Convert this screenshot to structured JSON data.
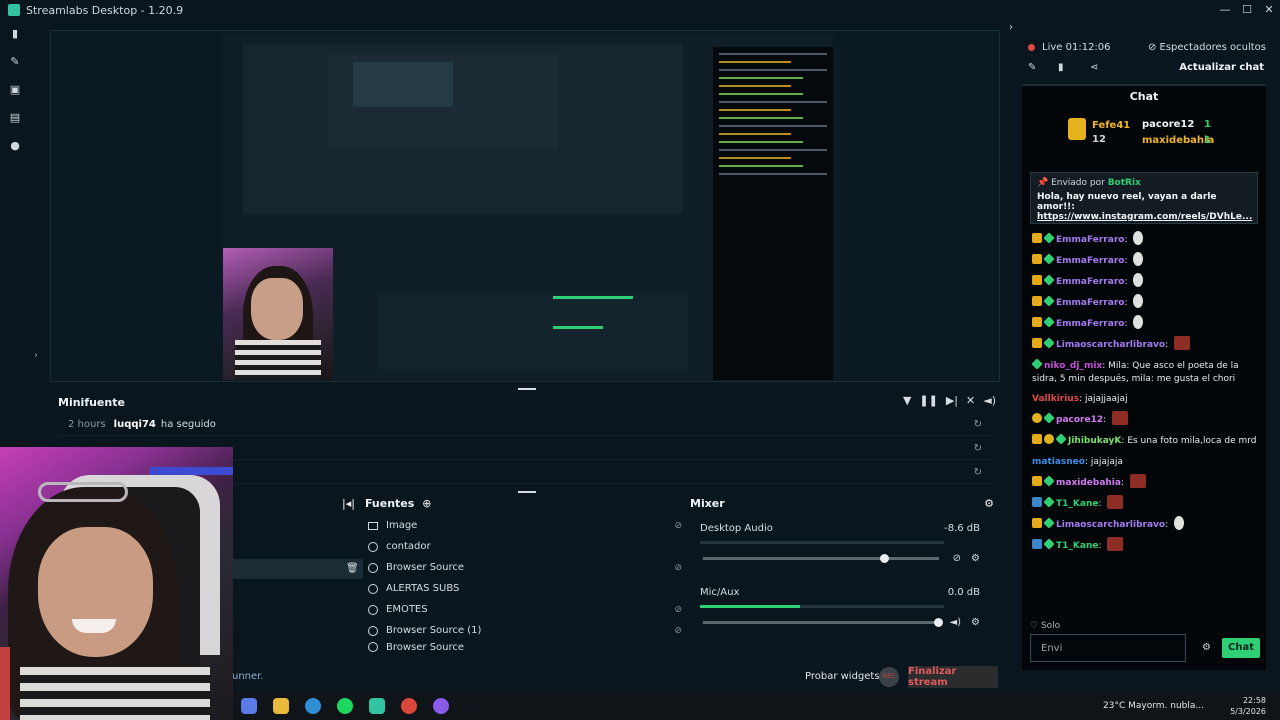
{
  "window": {
    "title": "Streamlabs Desktop - 1.20.9",
    "controls": [
      "—",
      "☐",
      "✕"
    ]
  },
  "nav": {
    "icons": [
      "editor-icon",
      "themes-icon",
      "store-icon",
      "dashboard-icon",
      "studio-icon"
    ],
    "collapse": "›"
  },
  "minifeed": {
    "title": "Minifuente",
    "rows": [
      {
        "time": "2 hours",
        "user": "luqqi74",
        "action": "ha seguido"
      },
      {
        "time": "",
        "user": "",
        "action": ""
      },
      {
        "time": "",
        "user": "",
        "action": ""
      }
    ]
  },
  "sources": {
    "title": "Fuentes",
    "items": [
      "Image",
      "contador",
      "Browser Source",
      "ALERTAS SUBS",
      "EMOTES",
      "Browser Source (1)",
      "Browser Source"
    ]
  },
  "mixer": {
    "title": "Mixer",
    "items": [
      {
        "name": "Desktop Audio",
        "db": "-8.6 dB",
        "level": 0.0,
        "volume": 0.77
      },
      {
        "name": "Mic/Aux",
        "db": "0.0 dB",
        "level": 0.41,
        "volume": 1.0
      }
    ]
  },
  "footer": {
    "widgets": "Probar widgets",
    "rec": "REC",
    "finish": "Finalizar stream",
    "runner": "unner."
  },
  "live": {
    "label": "Live",
    "time": "01:12:06",
    "viewers": "Espectadores ocultos",
    "update": "Actualizar chat"
  },
  "chat": {
    "title": "Chat",
    "leader": {
      "first": "Fefe41",
      "first_count": "12",
      "second": "pacore12",
      "second_count": "1",
      "third": "maxidebahia",
      "third_count": "1"
    },
    "pinned": {
      "sent_by": "Enviado por",
      "bot": "BotRix",
      "message": "Hola, hay nuevo reel, vayan a darle amor!!:",
      "link": "https://www.instagram.com/reels/DVhLe..."
    },
    "messages": [
      {
        "user": "EmmaFerraro",
        "color": "#a67bf2",
        "text": ""
      },
      {
        "user": "EmmaFerraro",
        "color": "#a67bf2",
        "text": ""
      },
      {
        "user": "EmmaFerraro",
        "color": "#a67bf2",
        "text": ""
      },
      {
        "user": "EmmaFerraro",
        "color": "#a67bf2",
        "text": ""
      },
      {
        "user": "EmmaFerraro",
        "color": "#a67bf2",
        "text": ""
      },
      {
        "user": "Limaoscarcharlibravo",
        "color": "#a67bf2",
        "text": ""
      },
      {
        "user": "niko_dj_mix",
        "color": "#c44fd6",
        "text": "Mila: Que asco el poeta de la sidra, 5 min después, mila: me gusta el chori"
      },
      {
        "user": "Vallkirius",
        "color": "#e24a4a",
        "text": "jajajjaajaj"
      },
      {
        "user": "pacore12",
        "color": "#d37bf2",
        "text": ""
      },
      {
        "user": "JihibukayK",
        "color": "#7be06b",
        "text": "Es una foto mila,loca de mrd"
      },
      {
        "user": "matiasneo",
        "color": "#3b8fe8",
        "text": "jajajaja"
      },
      {
        "user": "maxidebahia",
        "color": "#d37bf2",
        "text": ""
      },
      {
        "user": "T1_Kane",
        "color": "#2fd075",
        "text": ""
      },
      {
        "user": "Limaoscarcharlibravo",
        "color": "#a67bf2",
        "text": ""
      },
      {
        "user": "T1_Kane",
        "color": "#2fd075",
        "text": ""
      }
    ],
    "solo": "Solo",
    "placeholder": "Envi",
    "send": "Chat"
  },
  "taskbar": {
    "weather": "23°C Mayorm. nubla...",
    "time": "22:58",
    "date": "5/3/2026"
  }
}
